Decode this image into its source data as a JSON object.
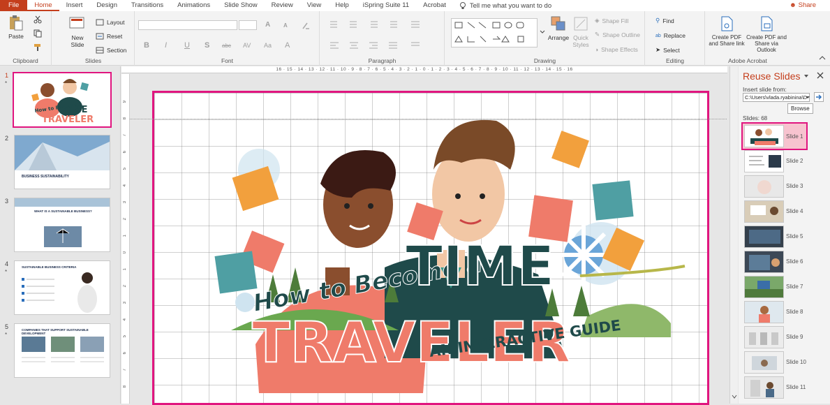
{
  "ribbon_tabs": [
    "File",
    "Home",
    "Insert",
    "Design",
    "Transitions",
    "Animations",
    "Slide Show",
    "Review",
    "View",
    "Help",
    "iSpring Suite 11",
    "Acrobat"
  ],
  "tell_me": "Tell me what you want to do",
  "share": "Share",
  "clipboard": {
    "paste": "Paste",
    "label": "Clipboard"
  },
  "slides_group": {
    "new_slide": "New Slide",
    "layout": "Layout",
    "reset": "Reset",
    "section": "Section",
    "label": "Slides"
  },
  "font_group": {
    "label": "Font",
    "font_size_up": "A",
    "font_size_down": "A",
    "bold": "B",
    "italic": "I",
    "underline": "U",
    "strike": "S",
    "abc": "abc",
    "av": "AV",
    "aa": "Aa",
    "font_color": "A"
  },
  "paragraph_group": {
    "label": "Paragraph"
  },
  "drawing_group": {
    "label": "Drawing",
    "arrange": "Arrange",
    "quick_styles": "Quick Styles",
    "shape_fill": "Shape Fill",
    "shape_outline": "Shape Outline",
    "shape_effects": "Shape Effects"
  },
  "editing_group": {
    "label": "Editing",
    "find": "Find",
    "replace": "Replace",
    "select": "Select"
  },
  "acrobat_group": {
    "label": "Adobe Acrobat",
    "create_pdf_share_link": "Create PDF and Share link",
    "create_pdf_outlook": "Create PDF and Share via Outlook"
  },
  "ruler_marks": "16 · 15 · 14 · 13 · 12 · 11 · 10 · 9 · 8 · 7 · 6 · 5 · 4 · 3 · 2 · 1 · 0 · 1 · 2 · 3 · 4 · 5 · 6 · 7 · 8 · 9 · 10 · 11 · 12 · 13 · 14 · 15 · 16",
  "ruler_left_marks": [
    "9",
    "8",
    "7",
    "6",
    "5",
    "4",
    "3",
    "2",
    "1",
    "0",
    "1",
    "2",
    "3",
    "4",
    "5",
    "6",
    "7",
    "8",
    "9"
  ],
  "thumbnails": [
    {
      "num": "1",
      "star": "*",
      "title": "How to Become a TIME TRAVELER"
    },
    {
      "num": "2",
      "star": "",
      "title": "BUSINESS SUSTAINABILITY"
    },
    {
      "num": "3",
      "star": "",
      "title": "WHAT IS A SUSTAINABLE BUSINESS?"
    },
    {
      "num": "4",
      "star": "*",
      "title": "SUSTAINABLE BUSINESS CRITERIA"
    },
    {
      "num": "5",
      "star": "*",
      "title": "COMPANIES THAT SUPPORT SUSTAINABLE DEVELOPMENT"
    }
  ],
  "slide": {
    "title_line1": "How to Become a",
    "title_time": "TIME",
    "title_traveler": "TRAVELER",
    "subtitle": "AN INTERACTIVE GUIDE"
  },
  "reuse_panel": {
    "title": "Reuse Slides",
    "insert_from": "Insert slide from:",
    "path": "C:\\Users\\vlada.ryabinina\\D",
    "browse": "Browse",
    "count": "Slides: 68",
    "slides": [
      "Slide 1",
      "Slide 2",
      "Slide 3",
      "Slide 4",
      "Slide 5",
      "Slide 6",
      "Slide 7",
      "Slide 8",
      "Slide 9",
      "Slide 10",
      "Slide 11"
    ]
  },
  "colors": {
    "accent": "#c43e1c",
    "highlight": "#e0157f",
    "teal": "#1f4a4a",
    "coral": "#ef7b6a"
  }
}
